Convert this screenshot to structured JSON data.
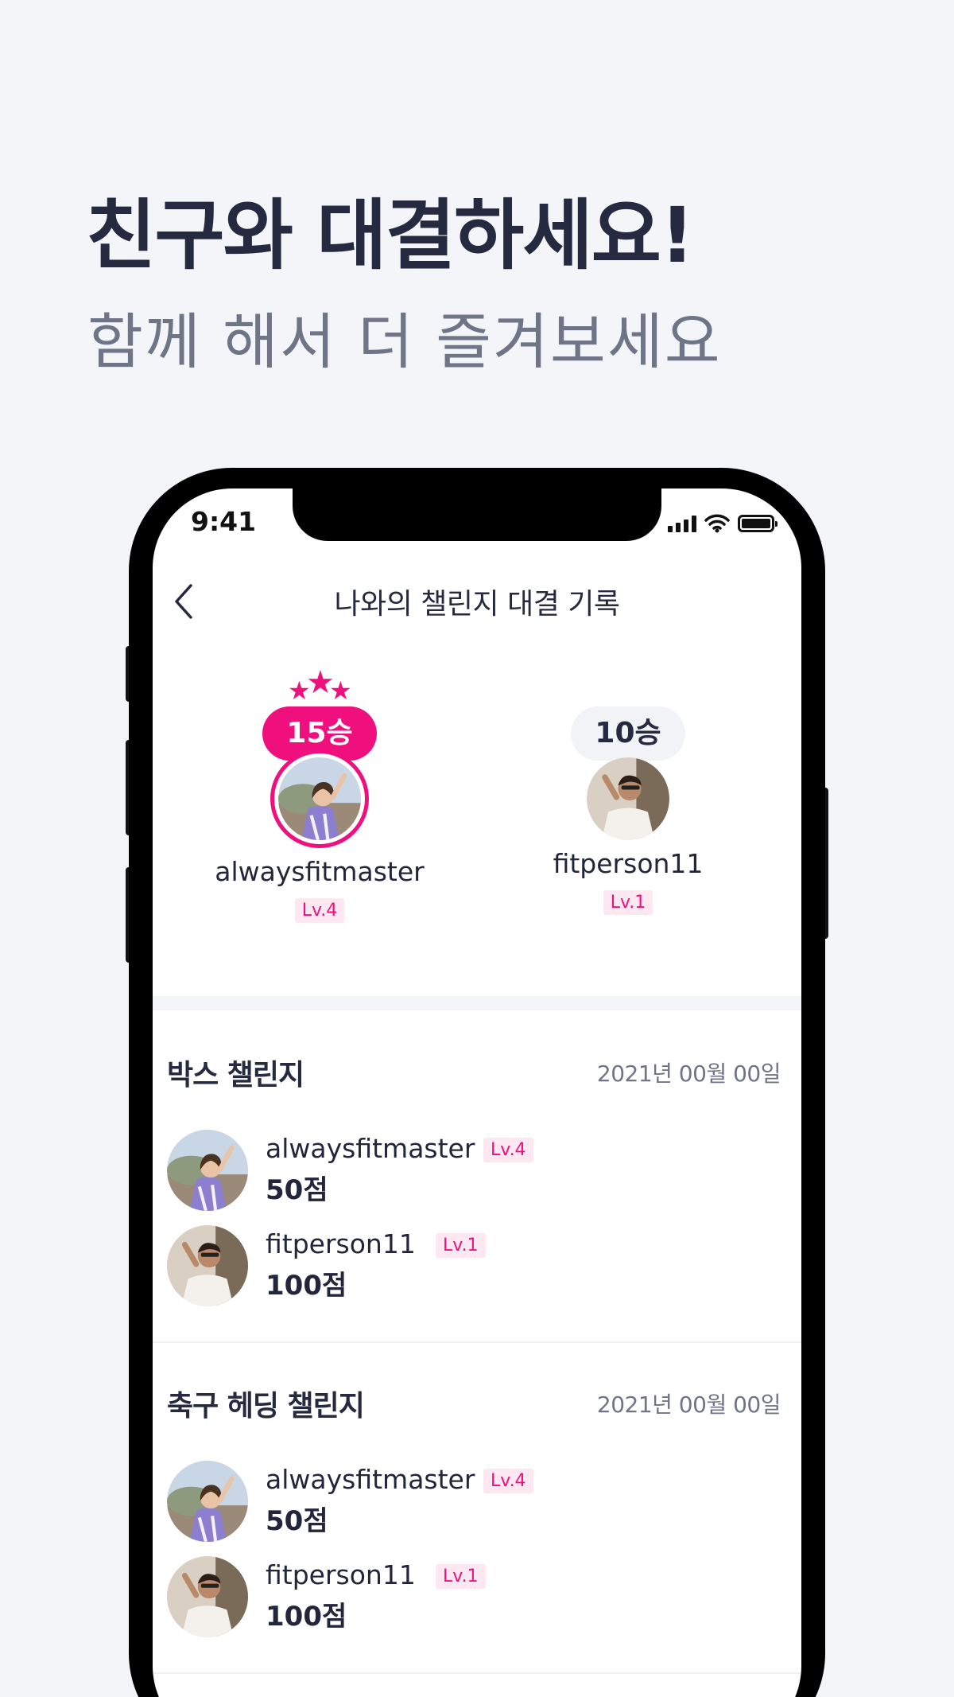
{
  "promo": {
    "title": "친구와 대결하세요!",
    "subtitle": "함께 해서 더 즐겨보세요"
  },
  "status_bar": {
    "time": "9:41"
  },
  "nav": {
    "back_icon": "chevron-left-icon",
    "title": "나와의 챌린지 대결 기록"
  },
  "versus": {
    "leader": {
      "wins": "15승",
      "name": "alwaysfitmaster",
      "level": "Lv.4",
      "stars": 3
    },
    "opponent": {
      "wins": "10승",
      "name": "fitperson11",
      "level": "Lv.1"
    }
  },
  "colors": {
    "accent": "#f0107d",
    "text": "#262a40",
    "muted": "#6f7487",
    "background": "#f3f5f9"
  },
  "challenges": [
    {
      "title": "박스 챌린지",
      "date": "2021년 00월 00일",
      "entries": [
        {
          "name": "alwaysfitmaster",
          "level": "Lv.4",
          "score": "50점"
        },
        {
          "name": "fitperson11",
          "level": "Lv.1",
          "score": "100점"
        }
      ]
    },
    {
      "title": "축구 헤딩 챌린지",
      "date": "2021년 00월 00일",
      "entries": [
        {
          "name": "alwaysfitmaster",
          "level": "Lv.4",
          "score": "50점"
        },
        {
          "name": "fitperson11",
          "level": "Lv.1",
          "score": "100점"
        }
      ]
    }
  ]
}
